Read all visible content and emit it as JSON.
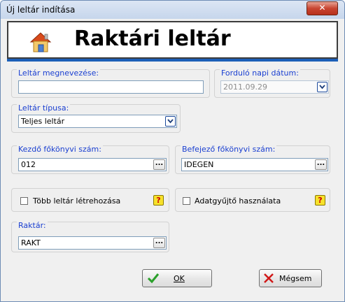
{
  "window": {
    "title": "Új leltár indítása",
    "close_glyph": "✕"
  },
  "header": {
    "title": "Raktári leltár",
    "icon": "home-icon"
  },
  "fields": {
    "name": {
      "label": "Leltár megnevezése:",
      "value": ""
    },
    "date": {
      "label": "Forduló napi dátum:",
      "value": "2011.09.29"
    },
    "type": {
      "label": "Leltár típusa:",
      "value": "Teljes leltár"
    },
    "ledger_start": {
      "label": "Kezdő főkönyvi szám:",
      "value": "012"
    },
    "ledger_end": {
      "label": "Befejező főkönyvi szám:",
      "value": "IDEGEN"
    },
    "multi": {
      "label": "Több leltár létrehozása",
      "checked": false
    },
    "collector": {
      "label": "Adatgyűjtő használata",
      "checked": false
    },
    "warehouse": {
      "label": "Raktár:",
      "value": "RAKT"
    }
  },
  "buttons": {
    "ok": {
      "label": "OK"
    },
    "cancel": {
      "label": "Mégsem"
    }
  },
  "ellipsis_glyph": "...",
  "help_glyph": "?",
  "colors": {
    "label": "#1a3fd1",
    "accent": "#1c5fb8",
    "ok_check": "#2aa02a",
    "cancel_x": "#d01818"
  }
}
